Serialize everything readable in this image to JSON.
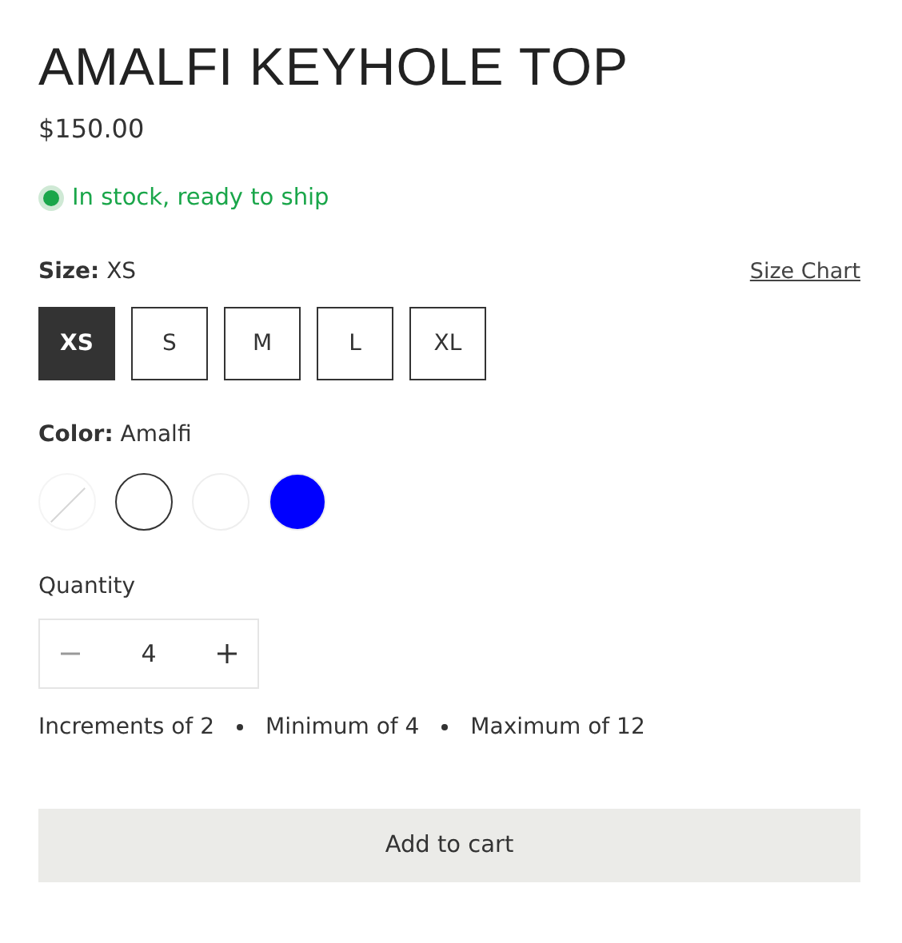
{
  "product": {
    "title": "AMALFI KEYHOLE TOP",
    "price": "$150.00"
  },
  "stock": {
    "text": "In stock, ready to ship",
    "in_stock": true
  },
  "size": {
    "label": "Size:",
    "value": "XS",
    "chart_link": "Size Chart",
    "options": [
      {
        "label": "XS",
        "selected": true
      },
      {
        "label": "S",
        "selected": false
      },
      {
        "label": "M",
        "selected": false
      },
      {
        "label": "L",
        "selected": false
      },
      {
        "label": "XL",
        "selected": false
      }
    ]
  },
  "color": {
    "label": "Color:",
    "value": "Amalfi",
    "swatches": [
      {
        "color": "#ffffff",
        "selected": false,
        "available": false
      },
      {
        "color": "#ffffff",
        "selected": true,
        "available": true
      },
      {
        "color": "#ffffff",
        "selected": false,
        "available": true
      },
      {
        "color": "#0000ff",
        "selected": false,
        "available": true
      }
    ]
  },
  "quantity": {
    "label": "Quantity",
    "value": "4",
    "decrease_disabled": true
  },
  "limits": [
    "Increments of 2",
    "Minimum of 4",
    "Maximum of 12"
  ],
  "add_to_cart": "Add to cart"
}
